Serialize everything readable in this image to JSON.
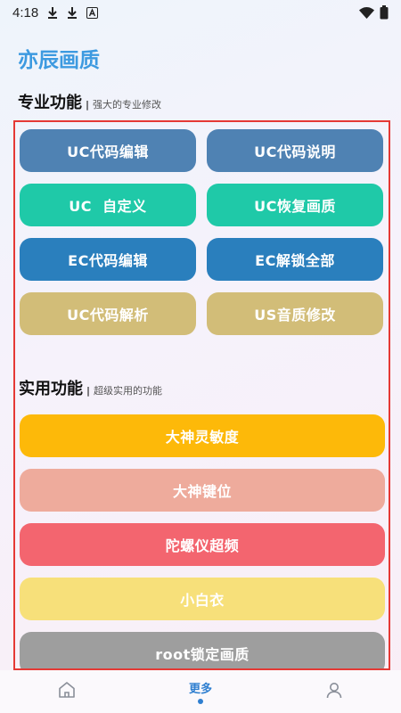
{
  "statusbar": {
    "time": "4:18",
    "icons": [
      "download-icon",
      "download-icon",
      "font-a-icon",
      "wifi-icon",
      "battery-icon"
    ]
  },
  "app": {
    "title": "亦辰画质"
  },
  "pro_section": {
    "title": "专业功能",
    "subtitle": "强大的专业修改",
    "buttons": [
      {
        "label": "UC代码编辑",
        "color": "#4f82b3"
      },
      {
        "label": "UC代码说明",
        "color": "#4f82b3"
      },
      {
        "label": "UC  自定义",
        "color": "#1fc9a8"
      },
      {
        "label": "UC恢复画质",
        "color": "#1fc9a8"
      },
      {
        "label": "EC代码编辑",
        "color": "#2a7fbd"
      },
      {
        "label": "EC解锁全部",
        "color": "#2a7fbd"
      },
      {
        "label": "UC代码解析",
        "color": "#d2bd78"
      },
      {
        "label": "US音质修改",
        "color": "#d2bd78"
      }
    ]
  },
  "util_section": {
    "title": "实用功能",
    "subtitle": "超级实用的功能",
    "buttons": [
      {
        "label": "大神灵敏度",
        "color": "#fdb909"
      },
      {
        "label": "大神键位",
        "color": "#eeab9c"
      },
      {
        "label": "陀螺仪超频",
        "color": "#f3656f"
      },
      {
        "label": "小白衣",
        "color": "#f7e07a"
      },
      {
        "label": "root锁定画质",
        "color": "#9e9e9e"
      }
    ]
  },
  "nav": {
    "items": [
      {
        "icon": "home-icon",
        "label": ""
      },
      {
        "icon": "",
        "label": "更多"
      },
      {
        "icon": "user-icon",
        "label": ""
      }
    ]
  }
}
